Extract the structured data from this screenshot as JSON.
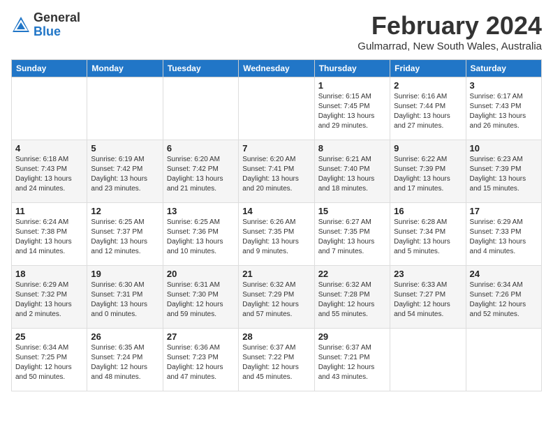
{
  "logo": {
    "general": "General",
    "blue": "Blue"
  },
  "header": {
    "month": "February 2024",
    "location": "Gulmarrad, New South Wales, Australia"
  },
  "days_of_week": [
    "Sunday",
    "Monday",
    "Tuesday",
    "Wednesday",
    "Thursday",
    "Friday",
    "Saturday"
  ],
  "weeks": [
    [
      {
        "day": "",
        "info": ""
      },
      {
        "day": "",
        "info": ""
      },
      {
        "day": "",
        "info": ""
      },
      {
        "day": "",
        "info": ""
      },
      {
        "day": "1",
        "info": "Sunrise: 6:15 AM\nSunset: 7:45 PM\nDaylight: 13 hours\nand 29 minutes."
      },
      {
        "day": "2",
        "info": "Sunrise: 6:16 AM\nSunset: 7:44 PM\nDaylight: 13 hours\nand 27 minutes."
      },
      {
        "day": "3",
        "info": "Sunrise: 6:17 AM\nSunset: 7:43 PM\nDaylight: 13 hours\nand 26 minutes."
      }
    ],
    [
      {
        "day": "4",
        "info": "Sunrise: 6:18 AM\nSunset: 7:43 PM\nDaylight: 13 hours\nand 24 minutes."
      },
      {
        "day": "5",
        "info": "Sunrise: 6:19 AM\nSunset: 7:42 PM\nDaylight: 13 hours\nand 23 minutes."
      },
      {
        "day": "6",
        "info": "Sunrise: 6:20 AM\nSunset: 7:42 PM\nDaylight: 13 hours\nand 21 minutes."
      },
      {
        "day": "7",
        "info": "Sunrise: 6:20 AM\nSunset: 7:41 PM\nDaylight: 13 hours\nand 20 minutes."
      },
      {
        "day": "8",
        "info": "Sunrise: 6:21 AM\nSunset: 7:40 PM\nDaylight: 13 hours\nand 18 minutes."
      },
      {
        "day": "9",
        "info": "Sunrise: 6:22 AM\nSunset: 7:39 PM\nDaylight: 13 hours\nand 17 minutes."
      },
      {
        "day": "10",
        "info": "Sunrise: 6:23 AM\nSunset: 7:39 PM\nDaylight: 13 hours\nand 15 minutes."
      }
    ],
    [
      {
        "day": "11",
        "info": "Sunrise: 6:24 AM\nSunset: 7:38 PM\nDaylight: 13 hours\nand 14 minutes."
      },
      {
        "day": "12",
        "info": "Sunrise: 6:25 AM\nSunset: 7:37 PM\nDaylight: 13 hours\nand 12 minutes."
      },
      {
        "day": "13",
        "info": "Sunrise: 6:25 AM\nSunset: 7:36 PM\nDaylight: 13 hours\nand 10 minutes."
      },
      {
        "day": "14",
        "info": "Sunrise: 6:26 AM\nSunset: 7:35 PM\nDaylight: 13 hours\nand 9 minutes."
      },
      {
        "day": "15",
        "info": "Sunrise: 6:27 AM\nSunset: 7:35 PM\nDaylight: 13 hours\nand 7 minutes."
      },
      {
        "day": "16",
        "info": "Sunrise: 6:28 AM\nSunset: 7:34 PM\nDaylight: 13 hours\nand 5 minutes."
      },
      {
        "day": "17",
        "info": "Sunrise: 6:29 AM\nSunset: 7:33 PM\nDaylight: 13 hours\nand 4 minutes."
      }
    ],
    [
      {
        "day": "18",
        "info": "Sunrise: 6:29 AM\nSunset: 7:32 PM\nDaylight: 13 hours\nand 2 minutes."
      },
      {
        "day": "19",
        "info": "Sunrise: 6:30 AM\nSunset: 7:31 PM\nDaylight: 13 hours\nand 0 minutes."
      },
      {
        "day": "20",
        "info": "Sunrise: 6:31 AM\nSunset: 7:30 PM\nDaylight: 12 hours\nand 59 minutes."
      },
      {
        "day": "21",
        "info": "Sunrise: 6:32 AM\nSunset: 7:29 PM\nDaylight: 12 hours\nand 57 minutes."
      },
      {
        "day": "22",
        "info": "Sunrise: 6:32 AM\nSunset: 7:28 PM\nDaylight: 12 hours\nand 55 minutes."
      },
      {
        "day": "23",
        "info": "Sunrise: 6:33 AM\nSunset: 7:27 PM\nDaylight: 12 hours\nand 54 minutes."
      },
      {
        "day": "24",
        "info": "Sunrise: 6:34 AM\nSunset: 7:26 PM\nDaylight: 12 hours\nand 52 minutes."
      }
    ],
    [
      {
        "day": "25",
        "info": "Sunrise: 6:34 AM\nSunset: 7:25 PM\nDaylight: 12 hours\nand 50 minutes."
      },
      {
        "day": "26",
        "info": "Sunrise: 6:35 AM\nSunset: 7:24 PM\nDaylight: 12 hours\nand 48 minutes."
      },
      {
        "day": "27",
        "info": "Sunrise: 6:36 AM\nSunset: 7:23 PM\nDaylight: 12 hours\nand 47 minutes."
      },
      {
        "day": "28",
        "info": "Sunrise: 6:37 AM\nSunset: 7:22 PM\nDaylight: 12 hours\nand 45 minutes."
      },
      {
        "day": "29",
        "info": "Sunrise: 6:37 AM\nSunset: 7:21 PM\nDaylight: 12 hours\nand 43 minutes."
      },
      {
        "day": "",
        "info": ""
      },
      {
        "day": "",
        "info": ""
      }
    ]
  ]
}
